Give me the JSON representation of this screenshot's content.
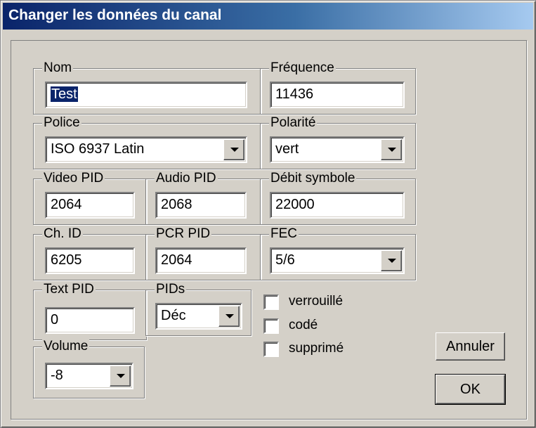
{
  "window": {
    "title": "Changer les données du canal"
  },
  "fields": {
    "nom": {
      "label": "Nom",
      "value": "Test"
    },
    "frequence": {
      "label": "Fréquence",
      "value": "11436"
    },
    "police": {
      "label": "Police",
      "value": "ISO 6937 Latin"
    },
    "polarite": {
      "label": "Polarité",
      "value": "vert"
    },
    "video_pid": {
      "label": "Video PID",
      "value": "2064"
    },
    "audio_pid": {
      "label": "Audio PID",
      "value": "2068"
    },
    "debit_symbole": {
      "label": "Débit symbole",
      "value": "22000"
    },
    "ch_id": {
      "label": "Ch. ID",
      "value": "6205"
    },
    "pcr_pid": {
      "label": "PCR PID",
      "value": "2064"
    },
    "fec": {
      "label": "FEC",
      "value": "5/6"
    },
    "text_pid": {
      "label": "Text PID",
      "value": "0"
    },
    "pids": {
      "label": "PIDs",
      "value": "Déc"
    },
    "volume": {
      "label": "Volume",
      "value": "-8"
    }
  },
  "checkboxes": [
    {
      "label": "verrouillé",
      "checked": false
    },
    {
      "label": "codé",
      "checked": false
    },
    {
      "label": "supprimé",
      "checked": false
    }
  ],
  "buttons": {
    "cancel": "Annuler",
    "ok": "OK"
  }
}
